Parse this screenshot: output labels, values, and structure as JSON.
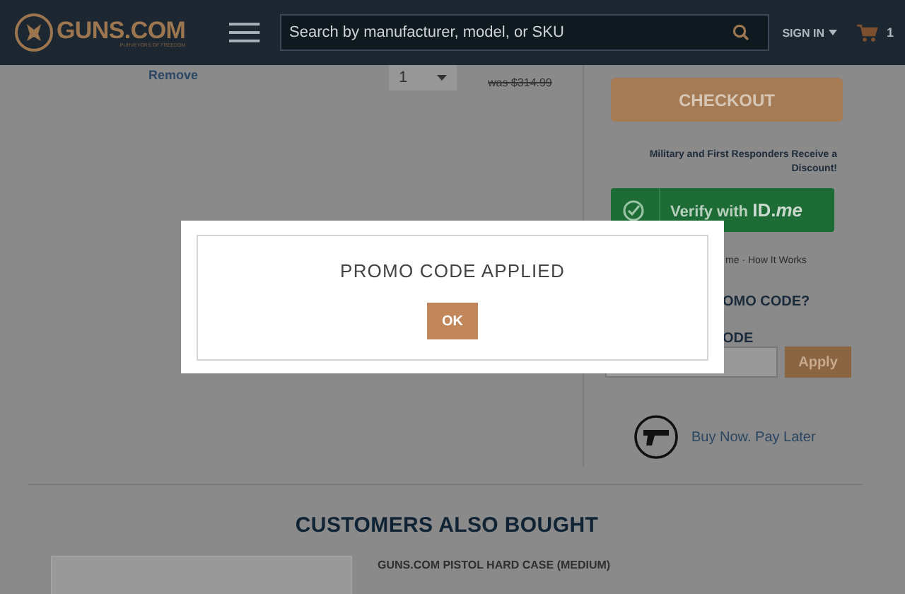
{
  "header": {
    "logo": "GUNS.COM",
    "tagline": "PURVEYORS OF FREEDOM",
    "search": {
      "placeholder": "Search by manufacturer, model, or SKU"
    },
    "sign_in": "SIGN IN",
    "cart_count": "1"
  },
  "cart_item": {
    "remove": "Remove",
    "quantity": "1",
    "was_price": "was $314.99"
  },
  "summary": {
    "checkout": "CHECKOUT",
    "military_note": "Military and First Responders Receive a Discount!",
    "verify_label": "Verify with",
    "verify_brand": "**ID**.*me*",
    "how_it_works": "me · How It Works",
    "promo_heading": "OMO CODE?",
    "promo_label": "ODE",
    "apply": "Apply",
    "pay_later": "Buy Now. Pay Later"
  },
  "recommendations": {
    "title": "CUSTOMERS ALSO BOUGHT",
    "products": [
      {
        "name": "GUNS.COM PISTOL HARD CASE (MEDIUM)"
      }
    ]
  },
  "modal": {
    "title": "PROMO CODE APPLIED",
    "button": "OK"
  }
}
